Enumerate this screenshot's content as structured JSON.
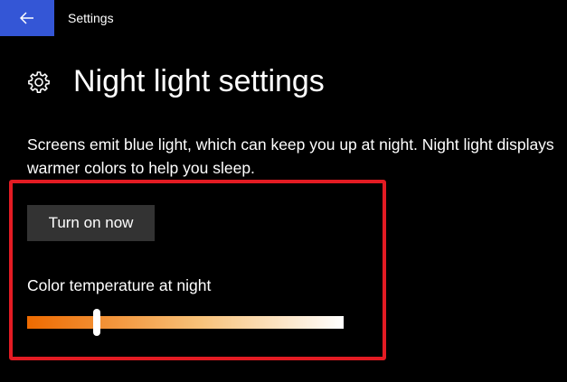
{
  "titlebar": {
    "back_icon": "arrow-left-icon",
    "title": "Settings"
  },
  "header": {
    "icon": "gear-icon",
    "title": "Night light settings"
  },
  "description": "Screens emit blue light, which can keep you up at night. Night light displays warmer colors to help you sleep.",
  "turn_on_button": {
    "label": "Turn on now"
  },
  "color_temperature": {
    "label": "Color temperature at night",
    "value": 0.22
  },
  "colors": {
    "accent": "#3456d6",
    "highlight_border": "#e31b23",
    "button_bg": "#333333",
    "gradient_warm": "#ee6a00",
    "gradient_mid": "#f7c27a",
    "gradient_cool": "#ffffff"
  }
}
